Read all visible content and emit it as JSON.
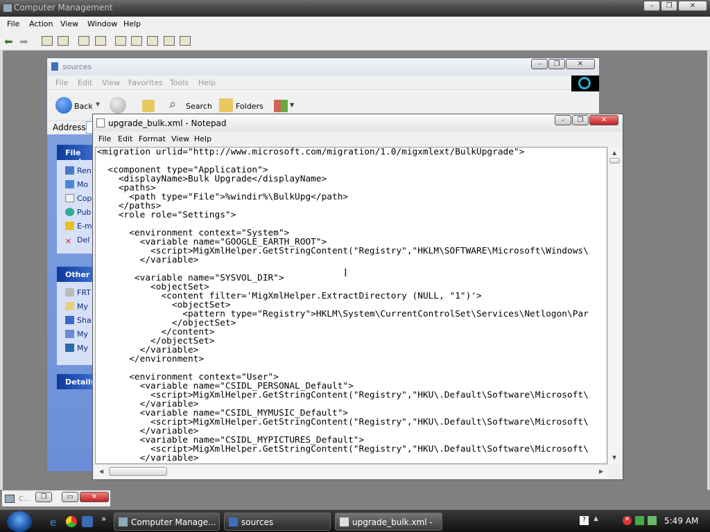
{
  "cm": {
    "title": "Computer Management",
    "menu": [
      "File",
      "Action",
      "View",
      "Window",
      "Help"
    ]
  },
  "explorer": {
    "title": "sources",
    "menu": [
      "File",
      "Edit",
      "View",
      "Favorites",
      "Tools",
      "Help"
    ],
    "toolbar": {
      "back": "Back",
      "search": "Search",
      "folders": "Folders"
    },
    "address_label": "Address",
    "panels": {
      "file_tasks_head": "File and",
      "file_tasks": [
        "Ren",
        "Mo",
        "Cop",
        "Pub",
        "E-m",
        "Del"
      ],
      "other_places_head": "Other",
      "other_places": [
        "FRT",
        "My",
        "Sha",
        "My",
        "My"
      ],
      "details_head": "Details"
    }
  },
  "notepad": {
    "title": "upgrade_bulk.xml - Notepad",
    "menu": [
      "File",
      "Edit",
      "Format",
      "View",
      "Help"
    ],
    "lines": [
      "<migration urlid=\"http://www.microsoft.com/migration/1.0/migxmlext/BulkUpgrade\">",
      "",
      "  <component type=\"Application\">",
      "    <displayName>Bulk Upgrade</displayName>",
      "    <paths>",
      "      <path type=\"File\">%windir%\\BulkUpg</path>",
      "    </paths>",
      "    <role role=\"Settings\">",
      "",
      "      <environment context=\"System\">",
      "        <variable name=\"GOOGLE_EARTH_ROOT\">",
      "          <script>MigXmlHelper.GetStringContent(\"Registry\",\"HKLM\\SOFTWARE\\Microsoft\\Windows\\",
      "        </variable>",
      "",
      "       <variable name=\"SYSVOL_DIR\">",
      "          <objectSet>",
      "            <content filter='MigXmlHelper.ExtractDirectory (NULL, \"1\")'>",
      "              <objectSet>",
      "                <pattern type=\"Registry\">HKLM\\System\\CurrentControlSet\\Services\\Netlogon\\Par",
      "              </objectSet>",
      "            </content>",
      "          </objectSet>",
      "        </variable>",
      "      </environment>",
      "",
      "      <environment context=\"User\">",
      "        <variable name=\"CSIDL_PERSONAL_Default\">",
      "          <script>MigXmlHelper.GetStringContent(\"Registry\",\"HKU\\.Default\\Software\\Microsoft\\",
      "        </variable>",
      "        <variable name=\"CSIDL_MYMUSIC_Default\">",
      "          <script>MigXmlHelper.GetStringContent(\"Registry\",\"HKU\\.Default\\Software\\Microsoft\\",
      "        </variable>",
      "        <variable name=\"CSIDL_MYPICTURES_Default\">",
      "          <script>MigXmlHelper.GetStringContent(\"Registry\",\"HKU\\.Default\\Software\\Microsoft\\",
      "        </variable>"
    ]
  },
  "minimized": {
    "label": "C..."
  },
  "taskbar": {
    "buttons": [
      "Computer Manage...",
      "sources",
      "upgrade_bulk.xml - ..."
    ],
    "clock": "5:49 AM"
  }
}
